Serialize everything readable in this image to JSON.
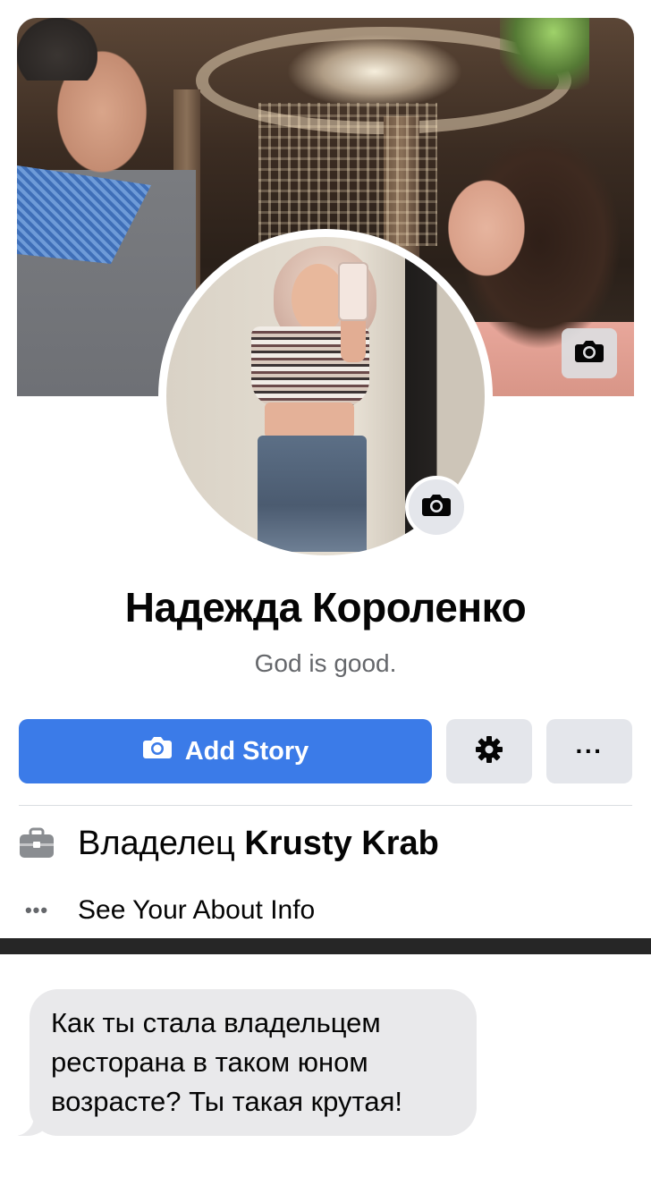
{
  "profile": {
    "name": "Надежда Короленко",
    "bio": "God is good.",
    "cover_camera_icon": "camera-icon",
    "avatar_camera_icon": "camera-icon"
  },
  "actions": {
    "add_story_label": "Add Story",
    "add_story_icon": "camera-icon",
    "settings_icon": "gear-icon",
    "more_label": "···",
    "accent_color": "#3b7be8"
  },
  "info": {
    "work_prefix": "Владелец",
    "work_place": "Krusty Krab",
    "work_icon": "briefcase-icon",
    "about_icon_label": "•••",
    "about_label": "See Your About Info"
  },
  "message": {
    "lines": [
      "Как ты стала владельцем",
      "ресторана в таком юном",
      "возрасте? Ты такая крутая!"
    ]
  }
}
